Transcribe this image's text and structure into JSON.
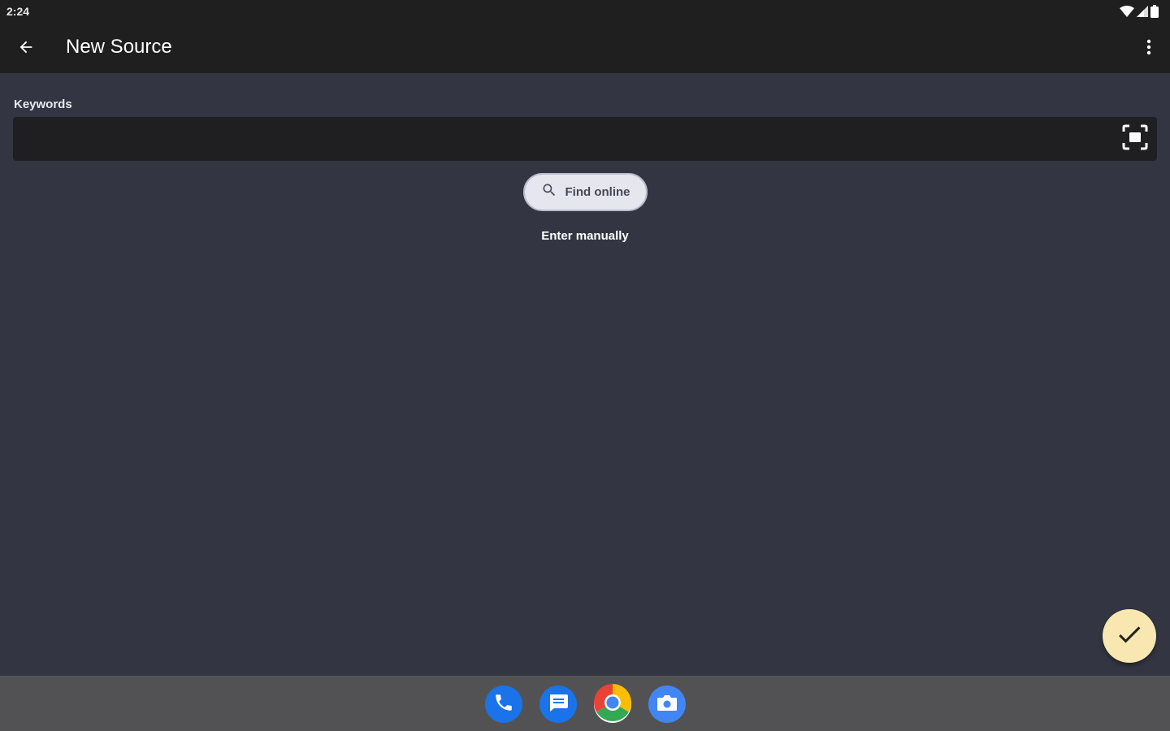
{
  "status_bar": {
    "time": "2:24",
    "icons": [
      "wifi-icon",
      "signal-icon",
      "battery-icon"
    ]
  },
  "app_bar": {
    "title": "New Source",
    "back_icon": "arrow-back-icon",
    "overflow_icon": "more-vert-icon"
  },
  "form": {
    "keywords_label": "Keywords",
    "keywords_value": "",
    "scan_icon": "barcode-scan-icon"
  },
  "actions": {
    "find_online_label": "Find online",
    "enter_manually_label": "Enter manually",
    "confirm_icon": "check-icon"
  },
  "dock": {
    "apps": [
      "Phone",
      "Messages",
      "Chrome",
      "Camera"
    ]
  },
  "colors": {
    "background": "#333642",
    "toolbar": "#1f1f1f",
    "fab": "#f8e7b0",
    "chip": "#e6e6ee",
    "dock": "#525254"
  }
}
